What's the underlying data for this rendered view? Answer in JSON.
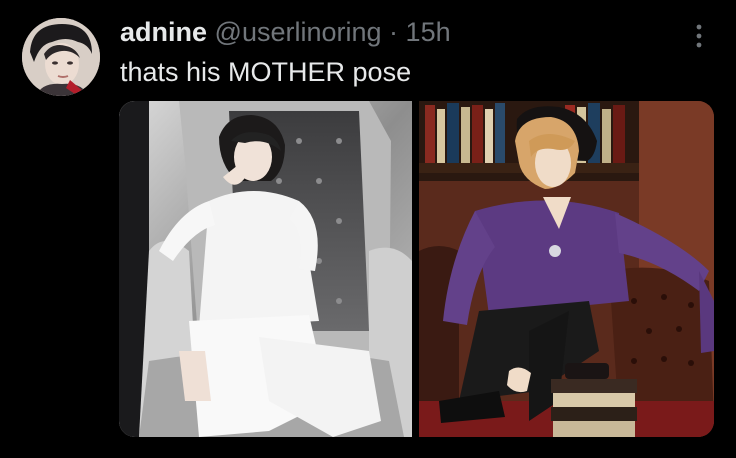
{
  "tweet": {
    "display_name": "adnine",
    "handle": "@userlinoring",
    "separator": "·",
    "time": "15h",
    "text": "thats his MOTHER pose"
  },
  "icons": {
    "more": "more-vertical-icon"
  },
  "media": {
    "count": 2,
    "images": [
      {
        "name": "photo-left"
      },
      {
        "name": "photo-right"
      }
    ]
  },
  "colors": {
    "background": "#000000",
    "text_primary": "#e7e9ea",
    "text_secondary": "#71767b"
  }
}
